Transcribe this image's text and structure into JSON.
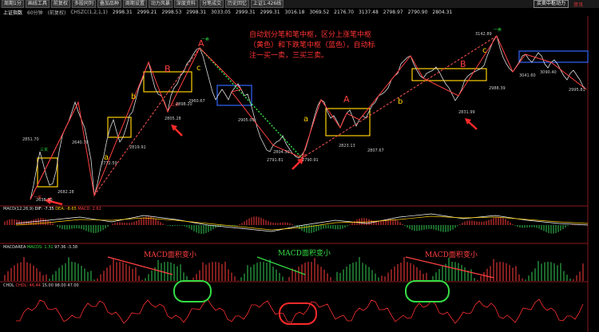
{
  "toolbar": {
    "buttons": [
      "周期1分",
      "画线工具",
      "前复权",
      "多股同列",
      "叠加品种",
      "周期设置",
      "动力风暴",
      "深度资料",
      "分笔成交",
      "历史回忆",
      "上证1.426线"
    ],
    "period_select": "买卖中枢动力",
    "right_text": "资讯"
  },
  "infobar": {
    "title": "上证指数",
    "period": "60分钟",
    "mode": "(前复权)",
    "indicator": "CHSZC(1,2,1,1)",
    "values": [
      "2998.31",
      "2999.21",
      "2998.53",
      "2998.31",
      "3033.05",
      "2999.31",
      "2999.31",
      "3016.18",
      "3069.52",
      "2176.70",
      "3137.48",
      "2798.97",
      "2790.90",
      "2804.31"
    ]
  },
  "annotation": {
    "lines": [
      "自动划分笔和笔中枢，区分上涨笔中枢",
      "（黄色）和下跌笔中枢（蓝色），自动标",
      "注一买一卖，三买三卖。"
    ]
  },
  "labels": {
    "A": "A",
    "B": "B",
    "a": "a",
    "b": "b",
    "c": "c",
    "buy1": "一买",
    "sell1": "一卖",
    "buy3": "三买",
    "sell3": "三卖"
  },
  "price_labels": [
    "2638.30",
    "2851.70",
    "2682.28",
    "2640.70",
    "2772.59",
    "2819.91",
    "2805.28",
    "2898.20",
    "2960.67",
    "2905.09",
    "2804.30",
    "2791.81",
    "2790.91",
    "2823.13",
    "2807.67",
    "2831.99",
    "2988.39",
    "3041.60",
    "3090.40",
    "2995.81",
    "3142.89"
  ],
  "macd": {
    "title": "MACD(12,26,9)",
    "dif": "DIF: -7.35",
    "dea": "DEA: -8.65",
    "macd": "MACD: 2.62",
    "area_title": "MACDAREA",
    "area_label": "MACDS: 1.31",
    "area_vals": [
      "97.36",
      "-3.38"
    ],
    "note1": "MACD面积变小",
    "note2": "MACD面积变小",
    "note3": "MACD面积变小"
  },
  "chdl": {
    "title": "CHDL",
    "vals": [
      "CHDL: 46.44",
      "15.00",
      "98.00",
      "47.00"
    ]
  },
  "colors": {
    "up": "#ff3b3b",
    "down": "#33cc55",
    "yellow": "#ffd000",
    "blue": "#3366ff",
    "green": "#33dd44"
  }
}
